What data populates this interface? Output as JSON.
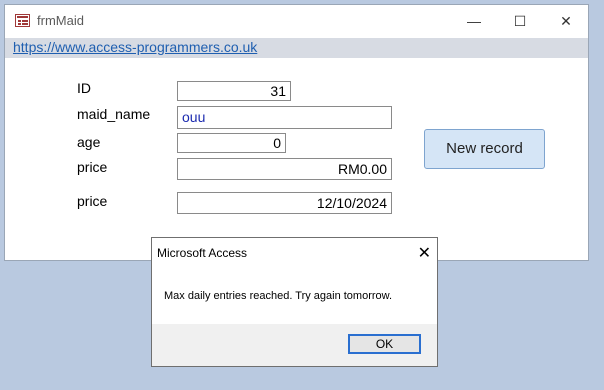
{
  "window": {
    "title": "frmMaid",
    "controls": {
      "minimize": "—",
      "maximize": "☐",
      "close": "✕"
    }
  },
  "header": {
    "link": "https://www.access-programmers.co.uk"
  },
  "form": {
    "fields": [
      {
        "label": "ID",
        "value": "31"
      },
      {
        "label": "maid_name",
        "value": "ouu"
      },
      {
        "label": "age",
        "value": "0"
      },
      {
        "label": "price",
        "value": "RM0.00"
      },
      {
        "label": "price",
        "value": "12/10/2024"
      }
    ],
    "new_record_label": "New record"
  },
  "dialog": {
    "title": "Microsoft Access",
    "close": "✕",
    "message": "Max daily entries reached.  Try again tomorrow.",
    "ok_label": "OK"
  }
}
